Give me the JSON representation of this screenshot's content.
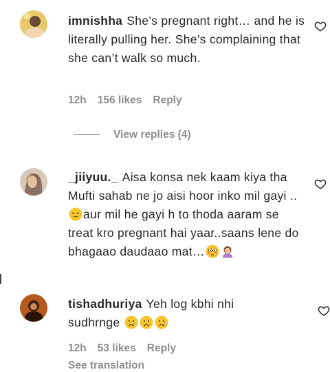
{
  "comments": [
    {
      "username": "imnishha",
      "text": "She’s pregnant right… and he is literally pulling her. She’s complaining that she can’t walk so much.",
      "time": "12h",
      "likes": "156 likes",
      "reply": "Reply",
      "view_replies": "View replies (4)"
    },
    {
      "username": "_jiiyuu._",
      "text_a": "Aisa konsa nek kaam kiya tha Mufti sahab ne jo aisi hoor inko mil gayi ..",
      "text_b": "aur mil he gayi h to thoda aaram se treat kro pregnant hai yaar..saans lene do bhagaao daudaao mat…",
      "emoji": [
        "pensive-face",
        "flushed-face",
        "woman-facepalming"
      ]
    },
    {
      "username": "tishadhuriya",
      "text": "Yeh log kbhi nhi sudhrnge",
      "emoji": [
        "crying-face",
        "crying-face",
        "crying-face"
      ],
      "time": "12h",
      "likes": "53 likes",
      "reply": "Reply",
      "see_translation": "See translation"
    }
  ],
  "icons": {
    "like": "heart-outline-icon"
  },
  "colors": {
    "text": "#262626",
    "meta": "#8e8e8e",
    "background": "#ffffff"
  }
}
